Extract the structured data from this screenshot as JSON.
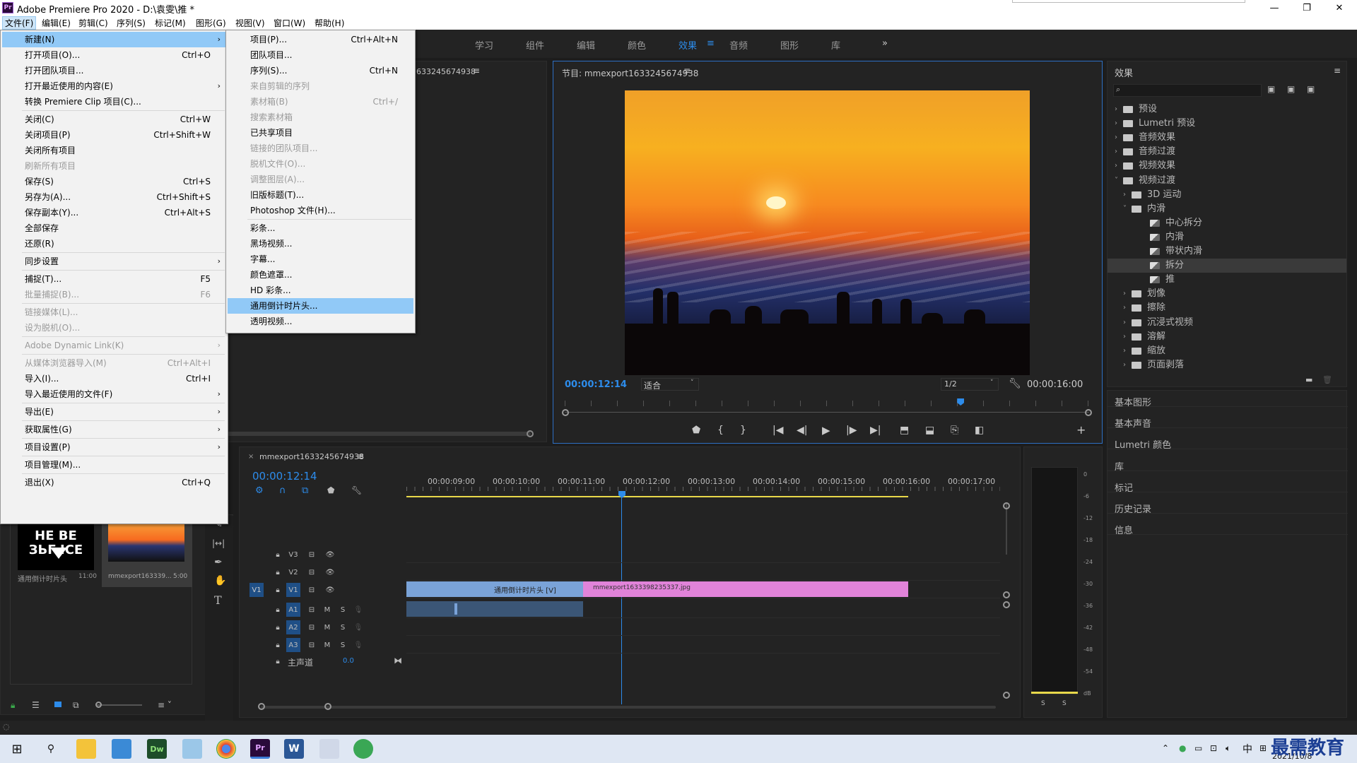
{
  "window": {
    "title": "Adobe Premiere Pro 2020 - D:\\袁雯\\推 *",
    "logo": "Pr",
    "controls": [
      "—",
      "❐",
      "✕"
    ]
  },
  "menubar": [
    "文件(F)",
    "编辑(E)",
    "剪辑(C)",
    "序列(S)",
    "标记(M)",
    "图形(G)",
    "视图(V)",
    "窗口(W)",
    "帮助(H)"
  ],
  "workspaces": [
    "学习",
    "组件",
    "编辑",
    "颜色",
    "效果",
    "音频",
    "图形",
    "库"
  ],
  "active_workspace": "效果",
  "ws_more": "»",
  "file_menu": [
    {
      "label": "新建(N)",
      "shortcut": "",
      "sub": true,
      "state": "hl"
    },
    {
      "label": "打开项目(O)...",
      "shortcut": "Ctrl+O"
    },
    {
      "label": "打开团队项目...",
      "shortcut": ""
    },
    {
      "label": "打开最近使用的内容(E)",
      "shortcut": "",
      "sub": true
    },
    {
      "label": "转换 Premiere Clip 项目(C)...",
      "shortcut": ""
    },
    {
      "sep": true
    },
    {
      "label": "关闭(C)",
      "shortcut": "Ctrl+W"
    },
    {
      "label": "关闭项目(P)",
      "shortcut": "Ctrl+Shift+W"
    },
    {
      "label": "关闭所有项目",
      "shortcut": ""
    },
    {
      "label": "刷新所有项目",
      "shortcut": "",
      "state": "dis"
    },
    {
      "label": "保存(S)",
      "shortcut": "Ctrl+S"
    },
    {
      "label": "另存为(A)...",
      "shortcut": "Ctrl+Shift+S"
    },
    {
      "label": "保存副本(Y)...",
      "shortcut": "Ctrl+Alt+S"
    },
    {
      "label": "全部保存",
      "shortcut": ""
    },
    {
      "label": "还原(R)",
      "shortcut": ""
    },
    {
      "sep": true
    },
    {
      "label": "同步设置",
      "shortcut": "",
      "sub": true
    },
    {
      "sep": true
    },
    {
      "label": "捕捉(T)...",
      "shortcut": "F5"
    },
    {
      "label": "批量捕捉(B)...",
      "shortcut": "F6",
      "state": "dis"
    },
    {
      "sep": true
    },
    {
      "label": "链接媒体(L)...",
      "shortcut": "",
      "state": "dis"
    },
    {
      "label": "设为脱机(O)...",
      "shortcut": "",
      "state": "dis"
    },
    {
      "sep": true
    },
    {
      "label": "Adobe Dynamic Link(K)",
      "shortcut": "",
      "sub": true,
      "state": "dis"
    },
    {
      "sep": true
    },
    {
      "label": "从媒体浏览器导入(M)",
      "shortcut": "Ctrl+Alt+I",
      "state": "dis"
    },
    {
      "label": "导入(I)...",
      "shortcut": "Ctrl+I"
    },
    {
      "label": "导入最近使用的文件(F)",
      "shortcut": "",
      "sub": true
    },
    {
      "sep": true
    },
    {
      "label": "导出(E)",
      "shortcut": "",
      "sub": true
    },
    {
      "sep": true
    },
    {
      "label": "获取属性(G)",
      "shortcut": "",
      "sub": true
    },
    {
      "sep": true
    },
    {
      "label": "项目设置(P)",
      "shortcut": "",
      "sub": true
    },
    {
      "sep": true
    },
    {
      "label": "项目管理(M)...",
      "shortcut": ""
    },
    {
      "sep": true
    },
    {
      "label": "退出(X)",
      "shortcut": "Ctrl+Q"
    }
  ],
  "new_menu": [
    {
      "label": "项目(P)...",
      "shortcut": "Ctrl+Alt+N"
    },
    {
      "label": "团队项目...",
      "shortcut": ""
    },
    {
      "label": "序列(S)...",
      "shortcut": "Ctrl+N"
    },
    {
      "label": "来自剪辑的序列",
      "shortcut": "",
      "state": "dis"
    },
    {
      "label": "素材箱(B)",
      "shortcut": "Ctrl+/",
      "state": "dis"
    },
    {
      "label": "搜索素材箱",
      "shortcut": "",
      "state": "dis"
    },
    {
      "label": "已共享项目",
      "shortcut": ""
    },
    {
      "label": "链接的团队项目...",
      "shortcut": "",
      "state": "dis"
    },
    {
      "label": "脱机文件(O)...",
      "shortcut": "",
      "state": "dis"
    },
    {
      "label": "调整图层(A)...",
      "shortcut": "",
      "state": "dis"
    },
    {
      "label": "旧版标题(T)...",
      "shortcut": ""
    },
    {
      "label": "Photoshop 文件(H)...",
      "shortcut": ""
    },
    {
      "sep": true
    },
    {
      "label": "彩条...",
      "shortcut": ""
    },
    {
      "label": "黑场视频...",
      "shortcut": ""
    },
    {
      "label": "字幕...",
      "shortcut": ""
    },
    {
      "label": "颜色遮罩...",
      "shortcut": ""
    },
    {
      "label": "HD 彩条...",
      "shortcut": ""
    },
    {
      "label": "通用倒计时片头...",
      "shortcut": "",
      "state": "hl"
    },
    {
      "label": "透明视频...",
      "shortcut": ""
    }
  ],
  "source_panel": {
    "tab": "633245674938",
    "menu": "≡"
  },
  "project_panel": {
    "items": [
      {
        "name": "通用倒计时片头",
        "dur": "11:00",
        "thumb_text": "НЕ ВЕ\nЗЬГ ICE"
      },
      {
        "name": "mmexport163339...",
        "dur": "5:00"
      }
    ]
  },
  "program": {
    "title": "节目: mmexport1633245674938",
    "menu": "≡",
    "timecode": "00:00:12:14",
    "fit": "适合",
    "res": "1/2",
    "duration": "00:00:16:00",
    "playhead_pct": 75.5
  },
  "timeline": {
    "close": "×",
    "tab": "mmexport1633245674938",
    "menu": "≡",
    "timecode": "00:00:12:14",
    "ruler": [
      "00:00:09:00",
      "00:00:10:00",
      "00:00:11:00",
      "00:00:12:00",
      "00:00:13:00",
      "00:00:14:00",
      "00:00:15:00",
      "00:00:16:00",
      "00:00:17:00"
    ],
    "tracks": [
      {
        "id": "V3",
        "type": "video"
      },
      {
        "id": "V2",
        "type": "video"
      },
      {
        "id": "V1",
        "type": "video",
        "src": "V1"
      },
      {
        "id": "A1",
        "type": "audio"
      },
      {
        "id": "A2",
        "type": "audio"
      },
      {
        "id": "A3",
        "type": "audio"
      }
    ],
    "master": {
      "label": "主声道",
      "value": "0.0"
    },
    "clips": [
      {
        "label": "通用倒计时片头 [V]"
      },
      {
        "label": "mmexport1633398235337.jpg"
      }
    ]
  },
  "meter": {
    "scale": [
      "0",
      "-6",
      "-12",
      "-18",
      "-24",
      "-30",
      "-36",
      "-42",
      "-48",
      "-54",
      "dB"
    ],
    "solo": [
      "S",
      "S"
    ]
  },
  "effects": {
    "title": "效果",
    "menu": "≡",
    "search_placeholder": "",
    "tree": [
      {
        "label": "预设",
        "level": 0,
        "open": false,
        "kind": "star"
      },
      {
        "label": "Lumetri 预设",
        "level": 0,
        "open": false,
        "kind": "star"
      },
      {
        "label": "音频效果",
        "level": 0,
        "open": false,
        "kind": "folder"
      },
      {
        "label": "音频过渡",
        "level": 0,
        "open": false,
        "kind": "folder"
      },
      {
        "label": "视频效果",
        "level": 0,
        "open": false,
        "kind": "folder"
      },
      {
        "label": "视频过渡",
        "level": 0,
        "open": true,
        "kind": "folder"
      },
      {
        "label": "3D 运动",
        "level": 1,
        "open": false,
        "kind": "folder"
      },
      {
        "label": "内滑",
        "level": 1,
        "open": true,
        "kind": "folder"
      },
      {
        "label": "中心拆分",
        "level": 2,
        "kind": "fx"
      },
      {
        "label": "内滑",
        "level": 2,
        "kind": "fx"
      },
      {
        "label": "带状内滑",
        "level": 2,
        "kind": "fx"
      },
      {
        "label": "拆分",
        "level": 2,
        "kind": "fx",
        "selected": true
      },
      {
        "label": "推",
        "level": 2,
        "kind": "fx"
      },
      {
        "label": "划像",
        "level": 1,
        "open": false,
        "kind": "folder"
      },
      {
        "label": "擦除",
        "level": 1,
        "open": false,
        "kind": "folder"
      },
      {
        "label": "沉浸式视频",
        "level": 1,
        "open": false,
        "kind": "folder"
      },
      {
        "label": "溶解",
        "level": 1,
        "open": false,
        "kind": "folder"
      },
      {
        "label": "缩放",
        "level": 1,
        "open": false,
        "kind": "folder"
      },
      {
        "label": "页面剥落",
        "level": 1,
        "open": false,
        "kind": "folder"
      }
    ]
  },
  "side_panels": [
    "基本图形",
    "基本声音",
    "Lumetri 颜色",
    "库",
    "标记",
    "历史记录",
    "信息"
  ],
  "taskbar": {
    "time": "",
    "date": "2021/10/8",
    "ime": "中",
    "watermark": "最需教育"
  },
  "colors": {
    "accent": "#2d8ceb",
    "clip_video": "#7aa3d8",
    "clip_image": "#e183d9",
    "menu_hl": "#91c9f7",
    "yellow": "#e8d84a"
  }
}
